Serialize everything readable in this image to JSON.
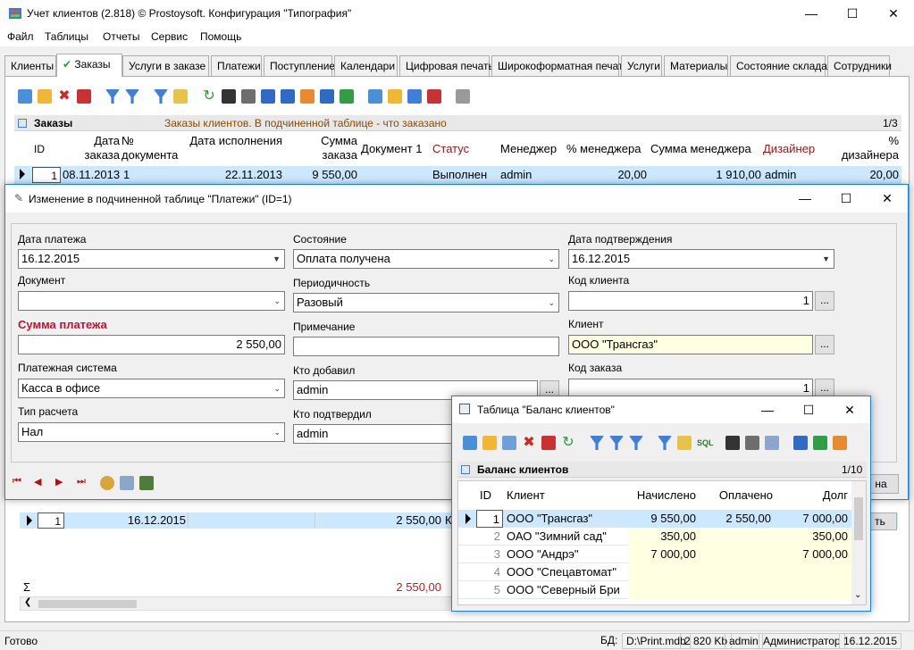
{
  "window": {
    "title": "Учет клиентов (2.818) © Prostoysoft. Конфигурация \"Типография\""
  },
  "menu": [
    "Файл",
    "Таблицы",
    "Отчеты",
    "Сервис",
    "Помощь"
  ],
  "tabs": [
    "Клиенты",
    "Заказы",
    "Услуги в заказе",
    "Платежи",
    "Поступление",
    "Календари",
    "Цифровая печать",
    "Широкоформатная печать",
    "Услуги",
    "Материалы",
    "Состояние склада",
    "Сотрудники"
  ],
  "orders": {
    "caption": "Заказы",
    "subtitle": "Заказы клиентов. В подчиненной таблице - что заказано",
    "counter": "1/3",
    "headers": {
      "id": "ID",
      "date": "Дата заказа",
      "docnum": "№ документа",
      "exec": "Дата исполнения",
      "sum": "Сумма заказа",
      "doc1": "Документ 1",
      "status": "Статус",
      "manager": "Менеджер",
      "mgr_pct": "% менеджера",
      "mgr_sum": "Сумма менеджера",
      "designer": "Дизайнер",
      "des_pct": "% дизайнера"
    },
    "row": {
      "id": "1",
      "date": "08.11.2013",
      "docnum": "1",
      "exec": "22.11.2013",
      "sum": "9 550,00",
      "status": "Выполнен",
      "manager": "admin",
      "mgr_pct": "20,00",
      "mgr_sum": "1 910,00",
      "designer": "admin",
      "des_pct": "20,00"
    }
  },
  "dialog": {
    "title": "Изменение в подчиненной таблице \"Платежи\" (ID=1)",
    "payment_date_label": "Дата платежа",
    "payment_date": "16.12.2015",
    "document_label": "Документ",
    "document_value": "",
    "amount_label": "Сумма платежа",
    "amount_value": "2 550,00",
    "paysys_label": "Платежная система",
    "paysys_value": "Касса в офисе",
    "calc_label": "Тип расчета",
    "calc_value": "Нал",
    "state_label": "Состояние",
    "state_value": "Оплата получена",
    "period_label": "Периодичность",
    "period_value": "Разовый",
    "note_label": "Примечание",
    "note_value": "",
    "added_label": "Кто добавил",
    "added_value": "admin",
    "confirmed_label": "Кто подтвердил",
    "confirmed_value": "admin",
    "confirm_date_label": "Дата подтверждения",
    "confirm_date": "16.12.2015",
    "client_code_label": "Код клиента",
    "client_code": "1",
    "client_label": "Клиент",
    "client_value": "ООО \"Трансгаз\"",
    "order_code_label": "Код заказа",
    "order_code": "1",
    "ellipsis": "..."
  },
  "payments": {
    "row": {
      "id": "1",
      "date": "16.12.2015",
      "sum": "2 550,00",
      "extra": "К"
    },
    "sum_label": "Σ",
    "total": "2 550,00",
    "button_partial1": "на",
    "button_partial2": "ть"
  },
  "balance": {
    "title": "Таблица \"Баланс клиентов\"",
    "caption": "Баланс клиентов",
    "counter": "1/10",
    "headers": {
      "id": "ID",
      "client": "Клиент",
      "accrued": "Начислено",
      "paid": "Оплачено",
      "debt": "Долг"
    },
    "rows": [
      {
        "id": "1",
        "client": "ООО \"Трансгаз\"",
        "accrued": "9 550,00",
        "paid": "2 550,00",
        "debt": "7 000,00"
      },
      {
        "id": "2",
        "client": "ОАО \"Зимний сад\"",
        "accrued": "350,00",
        "paid": "",
        "debt": "350,00"
      },
      {
        "id": "3",
        "client": "ООО \"Андрэ\"",
        "accrued": "7 000,00",
        "paid": "",
        "debt": "7 000,00"
      },
      {
        "id": "4",
        "client": "ООО \"Спецавтомат\"",
        "accrued": "",
        "paid": "",
        "debt": ""
      },
      {
        "id": "5",
        "client": "ООО \"Северный Бри",
        "accrued": "",
        "paid": "",
        "debt": ""
      }
    ]
  },
  "status": {
    "ready": "Готово",
    "db_label": "БД:",
    "db": "D:\\Print.mdb",
    "size": "2 820 Kb",
    "user": "admin",
    "role": "Администратор",
    "date": "16.12.2015"
  },
  "colors": {
    "accent": "#1883d7",
    "required": "#c8102e",
    "selection": "#cce8ff",
    "yellow": "#ffffe1"
  }
}
